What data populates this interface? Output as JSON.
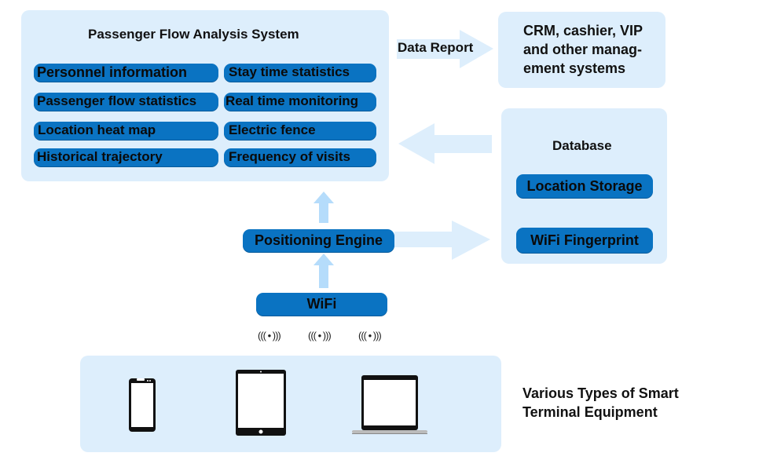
{
  "passenger_flow_system": {
    "title": "Passenger Flow Analysis System",
    "features": [
      "Personnel information",
      "Stay time statistics",
      "Passenger flow statistics",
      "Real time monitoring",
      "Location heat map",
      "Electric fence",
      "Historical trajectory",
      "Frequency of visits"
    ]
  },
  "data_report": {
    "label": "Data Report"
  },
  "management_systems": {
    "label": "CRM, cashier, VIP and other manag-ement systems",
    "line1": "CRM, cashier, VIP",
    "line2": "and other manag-",
    "line3": "ement systems"
  },
  "database": {
    "title": "Database",
    "items": [
      "Location Storage",
      "WiFi Fingerprint"
    ]
  },
  "positioning_engine": {
    "label": "Positioning Engine"
  },
  "wifi": {
    "label": "WiFi",
    "signal_glyph": "((( • )))"
  },
  "terminals": {
    "label_line1": "Various Types of Smart",
    "label_line2": "Terminal Equipment",
    "devices": [
      "smartphone",
      "tablet",
      "laptop"
    ]
  },
  "colors": {
    "panel": "#ddeefc",
    "pill": "#0a73c2",
    "arrow": "#b5dcfb"
  }
}
